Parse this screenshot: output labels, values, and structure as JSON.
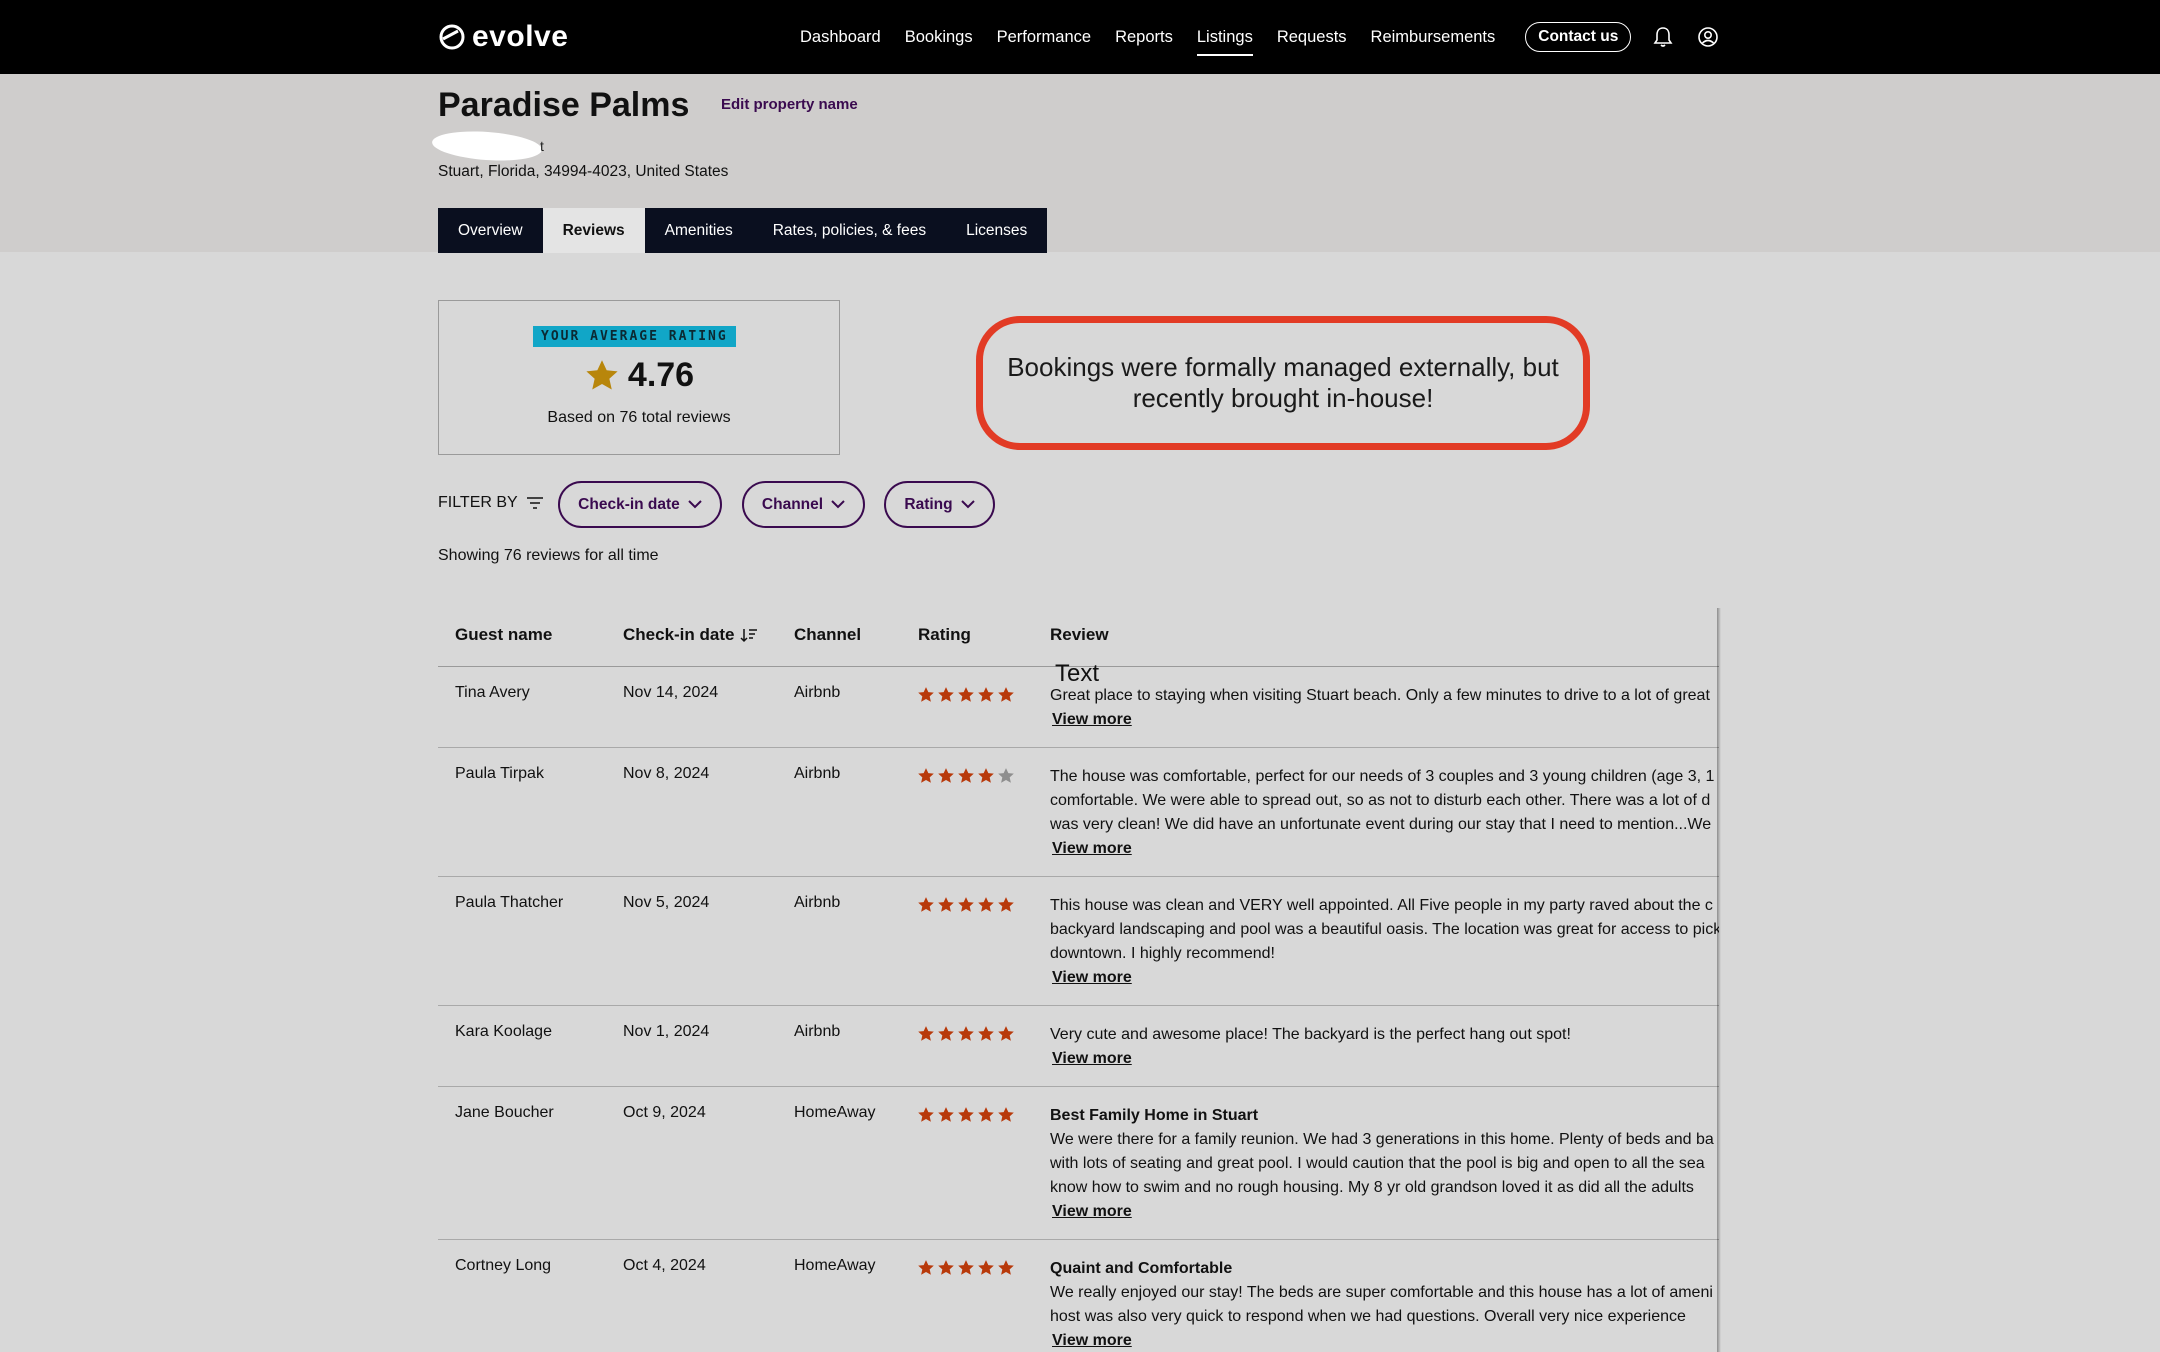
{
  "nav": {
    "logo": "evolve",
    "links": [
      "Dashboard",
      "Bookings",
      "Performance",
      "Reports",
      "Listings",
      "Requests",
      "Reimbursements"
    ],
    "active": "Listings",
    "contact": "Contact us"
  },
  "property": {
    "title": "Paradise Palms",
    "edit_label": "Edit property name",
    "address_fragment": "t",
    "address": "Stuart, Florida, 34994-4023, United States"
  },
  "tabs": [
    "Overview",
    "Reviews",
    "Amenities",
    "Rates, policies, & fees",
    "Licenses"
  ],
  "active_tab": "Reviews",
  "rating": {
    "badge": "YOUR AVERAGE RATING",
    "value": "4.76",
    "subtitle": "Based on 76 total reviews"
  },
  "callout": "Bookings were formally managed externally, but recently brought in-house!",
  "filters": {
    "label": "FILTER BY",
    "pills": [
      "Check-in date",
      "Channel",
      "Rating"
    ]
  },
  "showing": "Showing 76 reviews for all time",
  "table": {
    "headers": [
      "Guest name",
      "Check-in date",
      "Channel",
      "Rating",
      "Review"
    ],
    "overlay": "Text",
    "view_more": "View more",
    "rows": [
      {
        "guest": "Tina Avery",
        "date": "Nov 14, 2024",
        "channel": "Airbnb",
        "rating": 5,
        "title": "",
        "lines": [
          "Great place to staying when visiting Stuart beach. Only a few minutes to drive to a lot of great"
        ]
      },
      {
        "guest": "Paula Tirpak",
        "date": "Nov 8, 2024",
        "channel": "Airbnb",
        "rating": 4,
        "title": "",
        "lines": [
          "The house was comfortable, perfect for our needs of 3 couples and 3 young children (age 3, 1",
          "comfortable. We were able to spread out, so as not to disturb each other. There was a lot of d",
          "was very clean! We did have an unfortunate event during our stay that I need to mention...We"
        ]
      },
      {
        "guest": "Paula Thatcher",
        "date": "Nov 5, 2024",
        "channel": "Airbnb",
        "rating": 5,
        "title": "",
        "lines": [
          "This house was clean and VERY well appointed. All Five people in my party raved about the c",
          "backyard landscaping and pool was a beautiful oasis. The location was great for access to pick",
          "downtown. I highly recommend!"
        ]
      },
      {
        "guest": "Kara Koolage",
        "date": "Nov 1, 2024",
        "channel": "Airbnb",
        "rating": 5,
        "title": "",
        "lines": [
          "Very cute and awesome place! The backyard is the perfect hang out spot!"
        ]
      },
      {
        "guest": "Jane Boucher",
        "date": "Oct 9, 2024",
        "channel": "HomeAway",
        "rating": 5,
        "title": "Best Family Home in Stuart",
        "lines": [
          "We were there for a family reunion. We had 3 generations in this home. Plenty of beds and ba",
          "with lots of seating and great pool. I would caution that the pool is big and open to all the sea",
          "know how to swim and no rough housing. My 8 yr old grandson loved it as did all the adults"
        ]
      },
      {
        "guest": "Cortney Long",
        "date": "Oct 4, 2024",
        "channel": "HomeAway",
        "rating": 5,
        "title": "Quaint and Comfortable",
        "lines": [
          "We really enjoyed our stay! The beds are super comfortable and this house has a lot of ameni",
          "host was also very quick to respond when we had questions. Overall very nice experience"
        ]
      }
    ]
  },
  "colors": {
    "nav_bg": "#000000",
    "brand_purple": "#3a0a4f",
    "badge_cyan": "#11a6c7",
    "star_orange": "#b8390a",
    "star_gold": "#b8860b",
    "callout_red": "#e23b25"
  },
  "icons": [
    "evolve-logo-icon",
    "bell-icon",
    "user-icon",
    "filter-icon",
    "chevron-down-icon",
    "sort-icon",
    "star-icon"
  ]
}
